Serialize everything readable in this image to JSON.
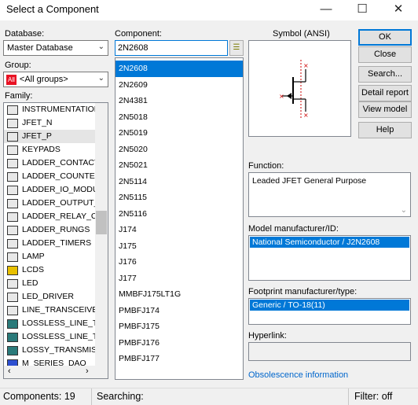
{
  "window": {
    "title": "Select a Component",
    "minimize": "—",
    "maximize": "☐",
    "close": "✕"
  },
  "database": {
    "label": "Database:",
    "value": "Master Database"
  },
  "group": {
    "label": "Group:",
    "badge": "All",
    "value": "<All groups>"
  },
  "family": {
    "label": "Family:",
    "items": [
      "INSTRUMENTATION_",
      "JFET_N",
      "JFET_P",
      "KEYPADS",
      "LADDER_CONTACTS",
      "LADDER_COUNTERS",
      "LADDER_IO_MODULI",
      "LADDER_OUTPUT_C",
      "LADDER_RELAY_COI",
      "LADDER_RUNGS",
      "LADDER_TIMERS",
      "LAMP",
      "LCDS",
      "LED",
      "LED_DRIVER",
      "LINE_TRANSCEIVER",
      "LOSSLESS_LINE_TYI",
      "LOSSLESS_LINE_TYI",
      "LOSSY_TRANSMISS",
      "M_SERIES_DAQ"
    ],
    "selected": "JFET_P"
  },
  "component": {
    "label": "Component:",
    "search_value": "2N2608",
    "items": [
      "2N2608",
      "2N2609",
      "2N4381",
      "2N5018",
      "2N5019",
      "2N5020",
      "2N5021",
      "2N5114",
      "2N5115",
      "2N5116",
      "J174",
      "J175",
      "J176",
      "J177",
      "MMBFJ175LT1G",
      "PMBFJ174",
      "PMBFJ175",
      "PMBFJ176",
      "PMBFJ177"
    ],
    "selected": "2N2608"
  },
  "symbol": {
    "label": "Symbol (ANSI)"
  },
  "function": {
    "label": "Function:",
    "value": "Leaded JFET General Purpose"
  },
  "model": {
    "label": "Model manufacturer/ID:",
    "value": "National Semiconductor / J2N2608"
  },
  "footprint": {
    "label": "Footprint manufacturer/type:",
    "value": "Generic / TO-18(11)"
  },
  "hyperlink": {
    "label": "Hyperlink:",
    "value": ""
  },
  "obsolescence": "Obsolescence information",
  "buttons": {
    "ok": "OK",
    "close": "Close",
    "search": "Search...",
    "detail_report": "Detail report",
    "view_model": "View model",
    "help": "Help"
  },
  "status": {
    "components": "Components: 19",
    "searching": "Searching:",
    "filter": "Filter: off"
  },
  "colors": {
    "accent": "#0078d7",
    "obsolescence_link": "#0066cc",
    "badge_red": "#e81123"
  }
}
